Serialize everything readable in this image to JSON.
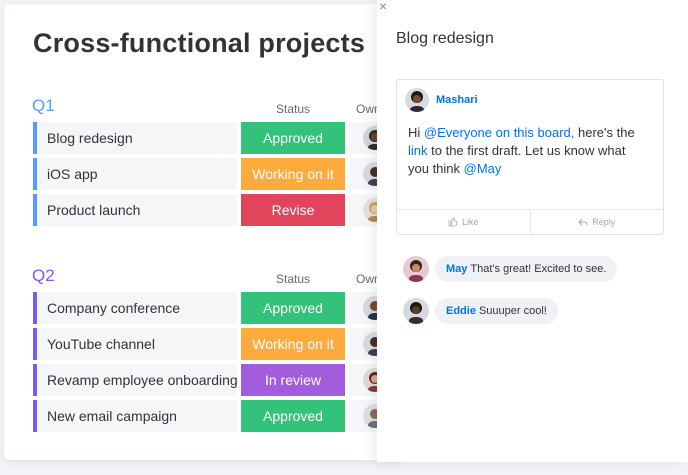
{
  "board": {
    "title": "Cross-functional projects",
    "columns": {
      "status": "Status",
      "owner": "Own"
    },
    "groups": [
      {
        "title": "Q1",
        "items": [
          {
            "name": "Blog redesign",
            "status": "Approved"
          },
          {
            "name": "iOS app",
            "status": "Working on it"
          },
          {
            "name": "Product launch",
            "status": "Revise"
          }
        ]
      },
      {
        "title": "Q2",
        "items": [
          {
            "name": "Company conference",
            "status": "Approved"
          },
          {
            "name": "YouTube channel",
            "status": "Working on it"
          },
          {
            "name": "Revamp employee onboarding",
            "status": "In review"
          },
          {
            "name": "New email campaign",
            "status": "Approved"
          }
        ]
      }
    ],
    "status_colors": {
      "Approved": "#33c279",
      "Working on it": "#fdab3d",
      "Revise": "#e2445c",
      "In review": "#a25ddc"
    }
  },
  "panel": {
    "close_glyph": "×",
    "title": "Blog redesign",
    "update": {
      "author": "Mashari",
      "body_parts": [
        {
          "text": "Hi ",
          "mention": false
        },
        {
          "text": "@Everyone on this board,",
          "mention": true
        },
        {
          "text": " here's the ",
          "mention": false
        },
        {
          "text": "link",
          "mention": true
        },
        {
          "text": " to the first draft. Let us know what you think ",
          "mention": false
        },
        {
          "text": "@May",
          "mention": true
        }
      ],
      "like_label": "Like",
      "reply_label": "Reply"
    },
    "replies": [
      {
        "author": "May",
        "text": "That's great! Excited to see."
      },
      {
        "author": "Eddie",
        "text": "Suuuper cool!"
      }
    ]
  },
  "icons": {
    "close": "close-icon",
    "like": "thumbs-up-icon",
    "reply": "reply-arrow-icon"
  }
}
